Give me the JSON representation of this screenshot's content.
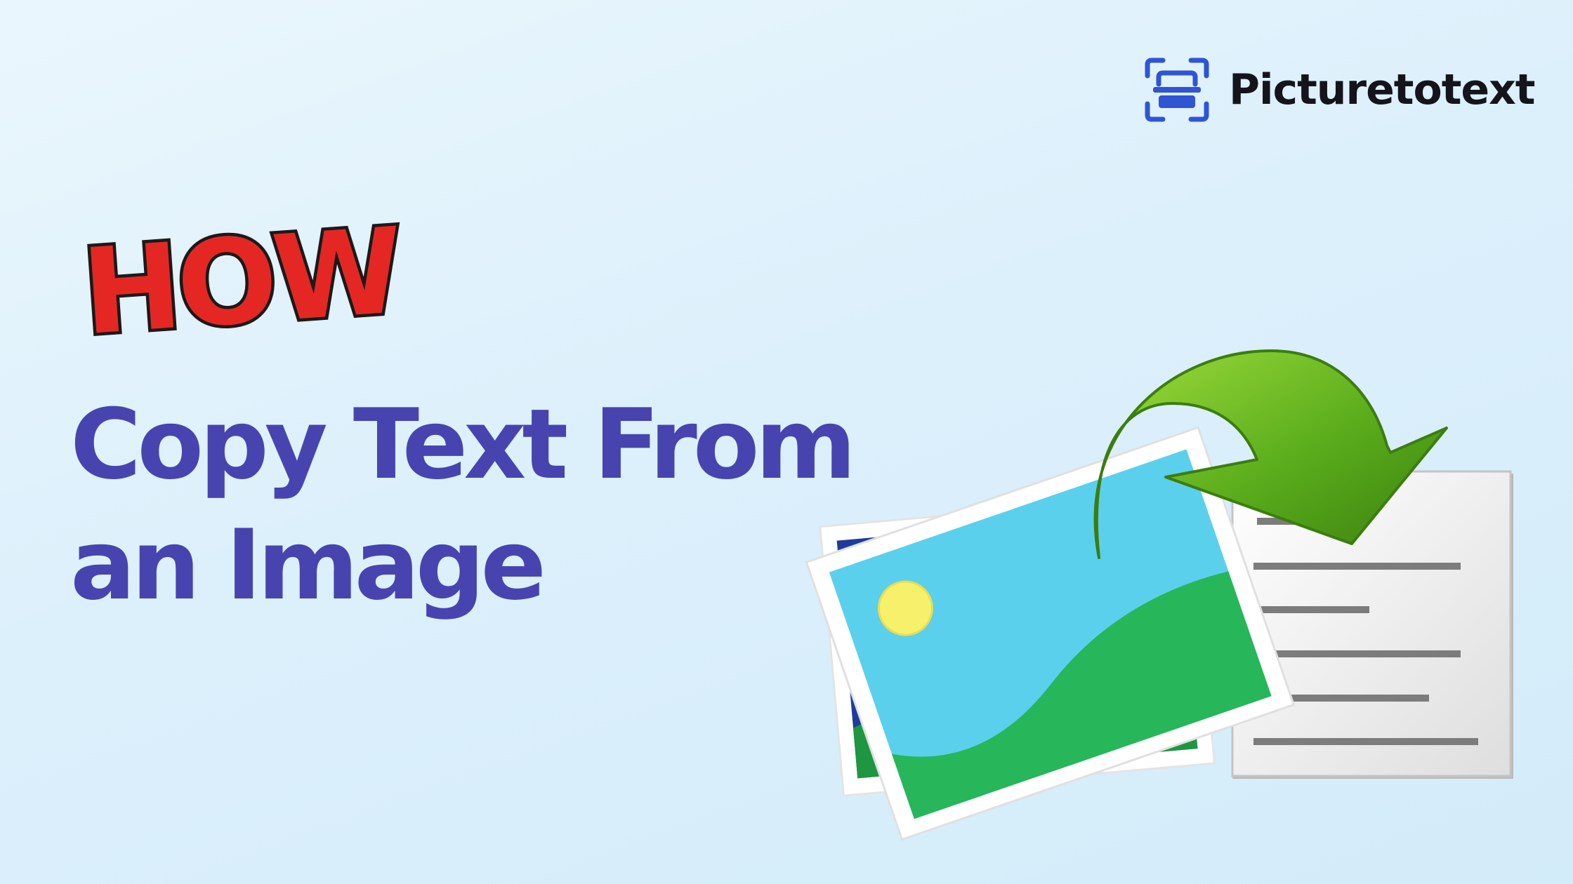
{
  "brand": {
    "name": "Picturetotext",
    "icon": "scan-frame-icon",
    "icon_color": "#2f55d4"
  },
  "how_word": {
    "text": "HOW?",
    "fill_color": "#e52724",
    "outline_color": "#1a1a1a"
  },
  "headline": {
    "line1": "Copy Text From",
    "line2": "an Image",
    "color": "#4744b0"
  },
  "illustration": {
    "photo_icon": "photo-icon",
    "arrow_icon": "curved-arrow-icon",
    "document_icon": "text-document-icon",
    "arrow_color": "#5aac1c",
    "sky_color": "#5bd0ec",
    "grass_color": "#27b65a",
    "sun_color": "#f7f06a"
  }
}
